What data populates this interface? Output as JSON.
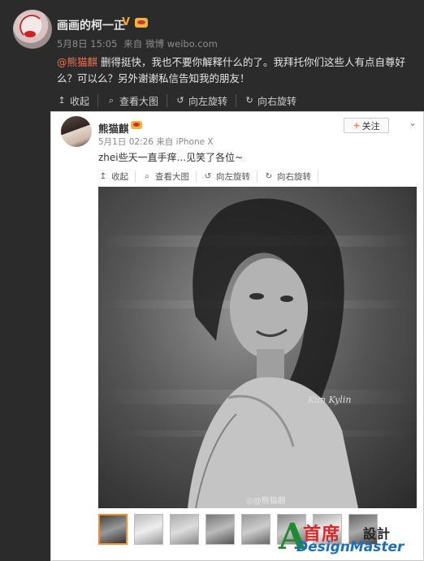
{
  "post": {
    "author": "画画的柯一正",
    "verified_mark": "V",
    "date": "5月8日 15:05",
    "source_prefix": "来自",
    "source": "微博 weibo.com",
    "mention": "@熊猫麒",
    "text_rest": " 删得挺快，我也不要你解释什么的了。我拜托你们这些人有点自尊好么？可以么？另外谢谢私信告知我的朋友！",
    "actions": [
      {
        "icon": "collapse-icon",
        "glyph": "↥",
        "label": "收起"
      },
      {
        "icon": "magnify-icon",
        "glyph": "⌕",
        "label": "查看大图"
      },
      {
        "icon": "rotate-left-icon",
        "glyph": "↺",
        "label": "向左旋转"
      },
      {
        "icon": "rotate-right-icon",
        "glyph": "↻",
        "label": "向右旋转"
      }
    ]
  },
  "card": {
    "author": "熊猫麒",
    "date": "5月1日 02:26",
    "source_prefix": "来自",
    "source": "iPhone X",
    "follow_label": "关注",
    "follow_plus": "+",
    "text": "zhei些天一直手痒...见笑了各位~",
    "actions": [
      {
        "icon": "collapse-icon",
        "glyph": "↥",
        "label": "收起"
      },
      {
        "icon": "magnify-icon",
        "glyph": "⌕",
        "label": "查看大图"
      },
      {
        "icon": "rotate-left-icon",
        "glyph": "↺",
        "label": "向左旋转"
      },
      {
        "icon": "rotate-right-icon",
        "glyph": "↻",
        "label": "向右旋转"
      }
    ],
    "photo_signature": "Kun Kylin",
    "photo_watermark": "@熊猫麒",
    "thumbnail_count": 9,
    "selected_thumbnail": 0
  },
  "logo": {
    "letter": "A",
    "cn_red": "首席",
    "cn_dark": "設計",
    "en": "DesignMaster"
  }
}
